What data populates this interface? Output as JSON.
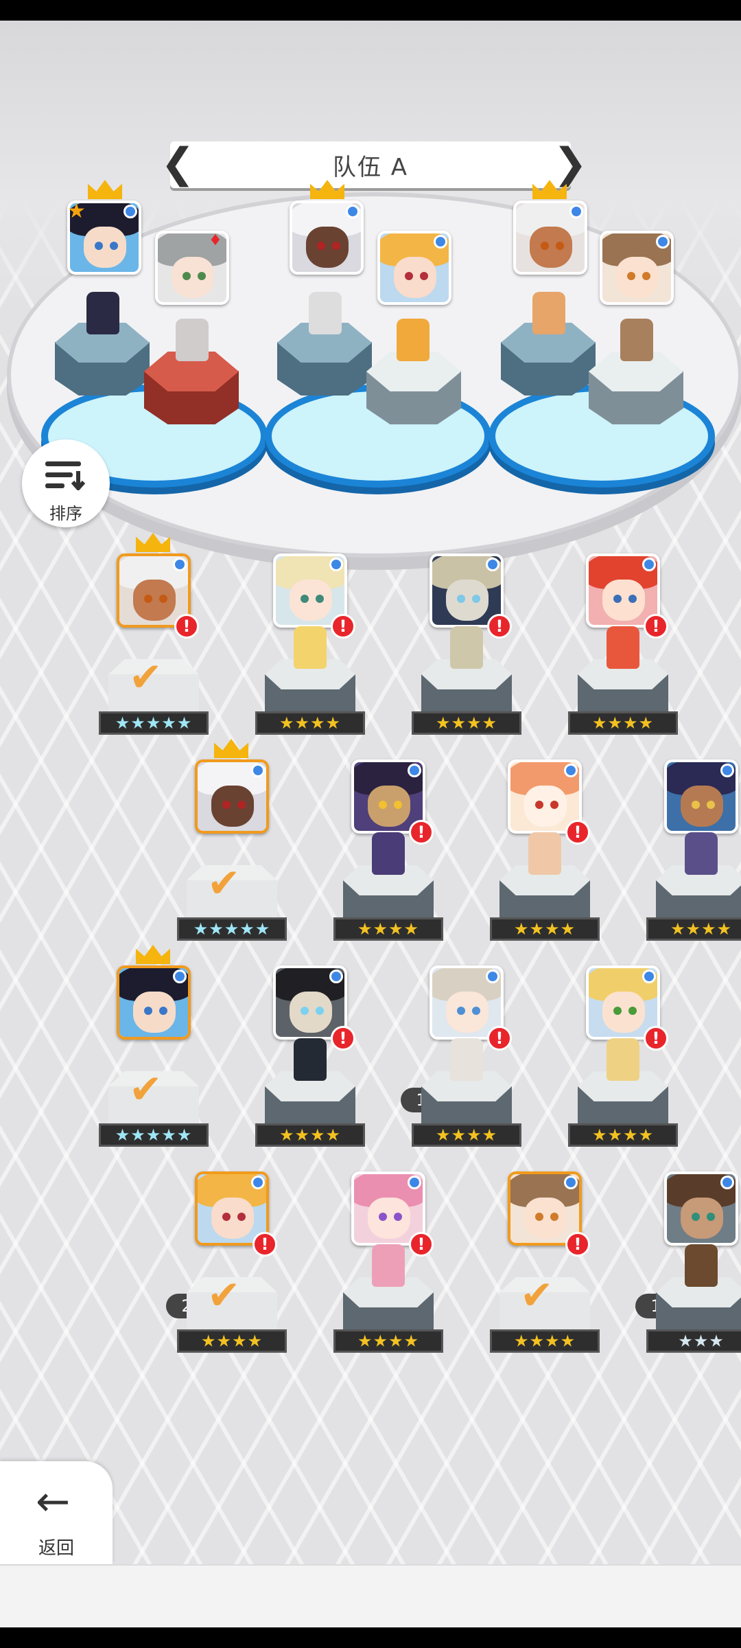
{
  "team": {
    "title": "队伍 A",
    "prev_label": "❮",
    "next_label": "❯"
  },
  "sort_button": {
    "label": "排序"
  },
  "back_button": {
    "label": "返回",
    "arrow": "←"
  },
  "icons": {
    "element": "blue-element-dot",
    "alert": "!",
    "check": "✔",
    "crown": "crown-icon",
    "leader": "★",
    "suit": "♦"
  },
  "roster_stars": {
    "row1": [
      "★★★★★",
      "★★★★",
      "★★★★",
      "★★★★"
    ],
    "row2": [
      "★★★★★",
      "★★★★",
      "★★★★",
      "★★★★"
    ],
    "row3": [
      "★★★★★",
      "★★★★",
      "★★★★",
      "★★★★"
    ],
    "row4": [
      "★★★★",
      "★★★★",
      "★★★★",
      "★★★"
    ]
  },
  "badges": {
    "b_r3": "1",
    "b_r4a": "2",
    "b_r4b": "1"
  },
  "alert_text": "!",
  "check_text": "✔",
  "colors": {
    "accent_orange": "#f19a1d",
    "element_blue": "#3d87e6",
    "alert_red": "#e8252b",
    "pool_blue": "#1b84d6"
  }
}
